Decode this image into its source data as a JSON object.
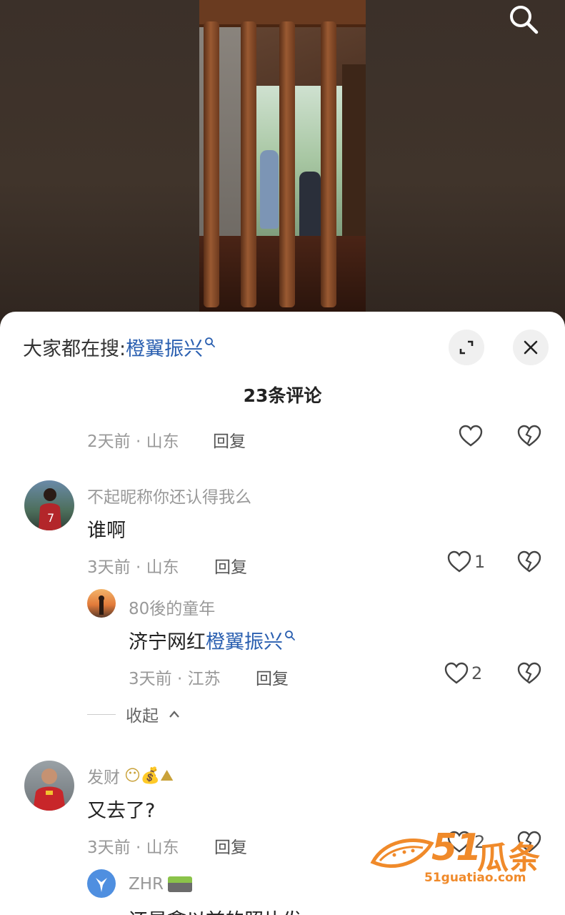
{
  "header": {
    "search_icon": "search-icon"
  },
  "sheet": {
    "trending_prefix": "大家都在搜:",
    "trending_keyword": "橙翼振兴",
    "expand_icon": "expand-icon",
    "close_icon": "close-icon",
    "comment_count": "23条评论"
  },
  "comments": [
    {
      "meta": "2天前 · 山东",
      "reply_label": "回复",
      "likes": ""
    },
    {
      "username": "不起昵称你还认得我么",
      "text": "谁啊",
      "meta": "3天前 · 山东",
      "reply_label": "回复",
      "likes": "1",
      "replies": [
        {
          "username": "80後的童年",
          "text_prefix": "济宁网红",
          "text_keyword": "橙翼振兴",
          "meta": "3天前 · 江苏",
          "reply_label": "回复",
          "likes": "2"
        }
      ],
      "collapse_label": "收起"
    },
    {
      "username": "发财",
      "username_emojis": "😶💰⛰",
      "text": "又去了?",
      "meta": "3天前 · 山东",
      "reply_label": "回复",
      "likes": "2",
      "replies": [
        {
          "username": "ZHR",
          "text": "还是拿以前的照片发"
        }
      ]
    }
  ],
  "watermark": {
    "number": "51",
    "name": "瓜条",
    "url": "51guatiao.com"
  },
  "colors": {
    "keyword": "#2a5fb0",
    "watermark": "#f08a2a"
  }
}
